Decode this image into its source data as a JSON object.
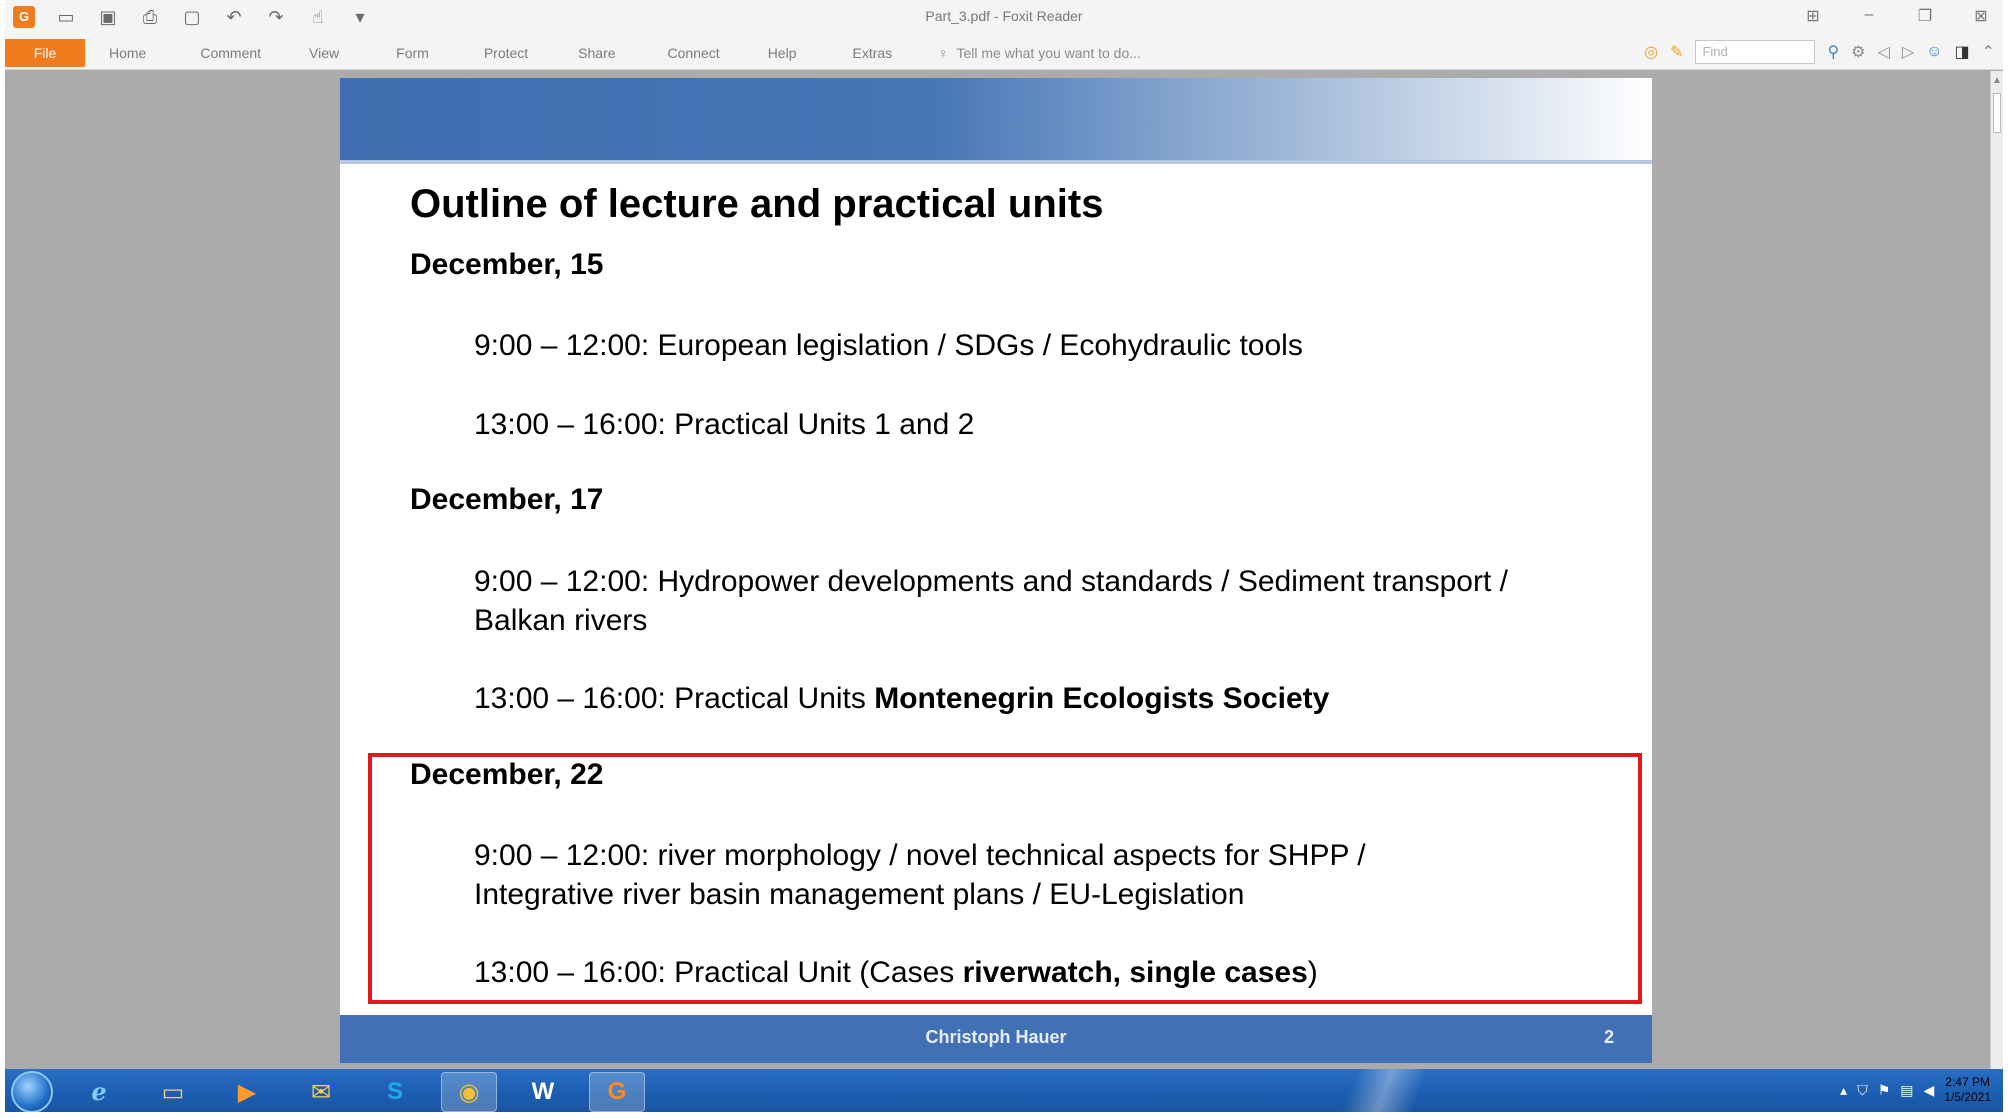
{
  "window": {
    "title": "Part_3.pdf - Foxit Reader"
  },
  "ribbon": {
    "file_label": "File",
    "tabs": [
      "Home",
      "Comment",
      "View",
      "Form",
      "Protect",
      "Share",
      "Connect",
      "Help",
      "Extras"
    ],
    "tell_me": "Tell me what you want to do...",
    "find_placeholder": "Find"
  },
  "slide": {
    "title": "Outline of lecture and practical units",
    "sections": [
      {
        "date": "December, 15",
        "entries": [
          {
            "text": "9:00 – 12:00: European legislation / SDGs / Ecohydraulic tools"
          },
          {
            "text": "13:00 – 16:00: Practical Units 1 and 2"
          }
        ]
      },
      {
        "date": "December, 17",
        "entries": [
          {
            "line1": "9:00 – 12:00: Hydropower developments and standards / Sediment transport /",
            "line2": "Balkan rivers"
          },
          {
            "prefix": "13:00 – 16:00: Practical Units ",
            "bold": "Montenegrin Ecologists Society"
          }
        ]
      },
      {
        "date": "December, 22",
        "entries": [
          {
            "line1": "9:00 – 12:00: river morphology / novel technical aspects for SHPP /",
            "line2": "Integrative river basin management plans / EU-Legislation"
          },
          {
            "prefix": "13:00 – 16:00: Practical Unit (Cases ",
            "bold": "riverwatch, single cases",
            "suffix": ")"
          }
        ]
      }
    ],
    "footer": {
      "author": "Christoph Hauer",
      "page": "2"
    },
    "highlight_color": "#e3161c"
  },
  "taskbar": {
    "clock_time": "2:47 PM",
    "clock_date": "1/5/2021"
  }
}
